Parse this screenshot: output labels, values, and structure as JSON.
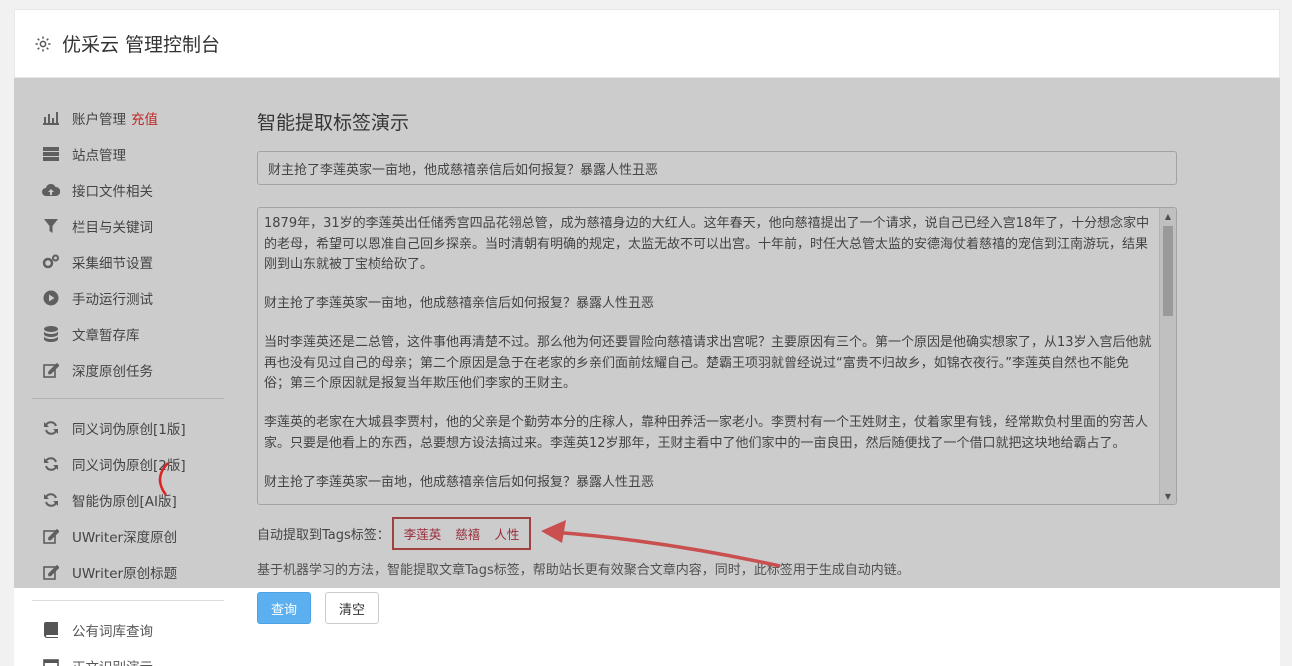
{
  "header": {
    "title": "优采云 管理控制台",
    "icon": "gear-icon"
  },
  "sidebar": {
    "items": [
      {
        "label": "账户管理",
        "badge": "充值",
        "icon": "bar-chart-icon"
      },
      {
        "label": "站点管理",
        "icon": "server-icon"
      },
      {
        "label": "接口文件相关",
        "icon": "cloud-upload-icon"
      },
      {
        "label": "栏目与关键词",
        "icon": "filter-icon"
      },
      {
        "label": "采集细节设置",
        "icon": "gears-icon"
      },
      {
        "label": "手动运行测试",
        "icon": "play-icon"
      },
      {
        "label": "文章暂存库",
        "icon": "database-icon"
      },
      {
        "label": "深度原创任务",
        "icon": "edit-icon"
      }
    ],
    "items2": [
      {
        "label": "同义词伪原创[1版]",
        "icon": "refresh-icon"
      },
      {
        "label": "同义词伪原创[2版]",
        "icon": "refresh-icon"
      },
      {
        "label": "智能伪原创[AI版]",
        "icon": "refresh-icon"
      },
      {
        "label": "UWriter深度原创",
        "icon": "edit-icon"
      },
      {
        "label": "UWriter原创标题",
        "icon": "edit-icon"
      }
    ],
    "items3": [
      {
        "label": "公有词库查询",
        "icon": "book-icon"
      },
      {
        "label": "正文识别演示",
        "icon": "window-icon"
      }
    ]
  },
  "main": {
    "heading": "智能提取标签演示",
    "title_value": "财主抢了李莲英家一亩地，他成慈禧亲信后如何报复？暴露人性丑恶",
    "paragraphs": [
      "1879年，31岁的李莲英出任储秀宫四品花翎总管，成为慈禧身边的大红人。这年春天，他向慈禧提出了一个请求，说自己已经入宫18年了，十分想念家中的老母，希望可以恩准自己回乡探亲。当时清朝有明确的规定，太监无故不可以出宫。十年前，时任大总管太监的安德海仗着慈禧的宠信到江南游玩，结果刚到山东就被丁宝桢给砍了。",
      "财主抢了李莲英家一亩地，他成慈禧亲信后如何报复？暴露人性丑恶",
      "当时李莲英还是二总管，这件事他再清楚不过。那么他为何还要冒险向慈禧请求出宫呢？主要原因有三个。第一个原因是他确实想家了，从13岁入宫后他就再也没有见过自己的母亲；第二个原因是急于在老家的乡亲们面前炫耀自己。楚霸王项羽就曾经说过“富贵不归故乡，如锦衣夜行。”李莲英自然也不能免俗；第三个原因就是报复当年欺压他们李家的王财主。",
      "李莲英的老家在大城县李贾村，他的父亲是个勤劳本分的庄稼人，靠种田养活一家老小。李贾村有一个王姓财主，仗着家里有钱，经常欺负村里面的穷苦人家。只要是他看上的东西，总要想方设法搞过来。李莲英12岁那年，王财主看中了他们家中的一亩良田，然后随便找了一个借口就把这块地给霸占了。",
      "财主抢了李莲英家一亩地，他成慈禧亲信后如何报复？暴露人性丑恶"
    ],
    "tags_label": "自动提取到Tags标签：",
    "tags": [
      "李莲英",
      "慈禧",
      "人性"
    ],
    "description": "基于机器学习的方法，智能提取文章Tags标签，帮助站长更有效聚合文章内容，同时，此标签用于生成自动内链。",
    "query_button": "查询",
    "clear_button": "清空"
  },
  "colors": {
    "primary": "#5cb0ef",
    "badge": "#e33333",
    "annotation": "#c9504f"
  }
}
